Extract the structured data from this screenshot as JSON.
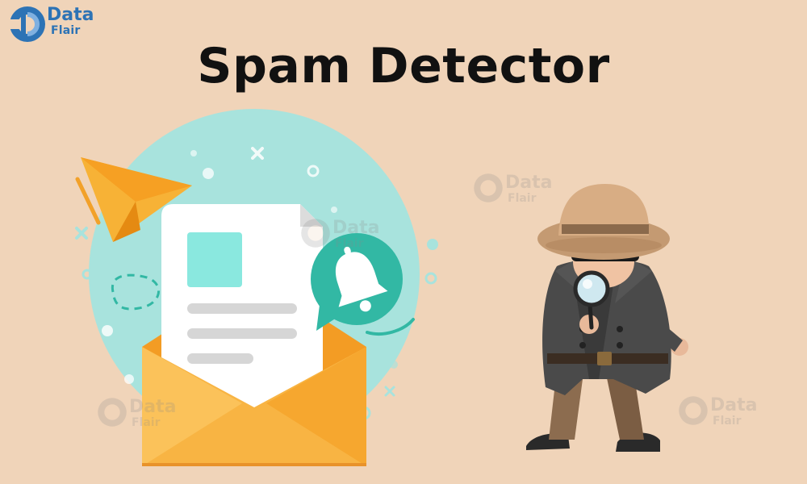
{
  "brand": {
    "line1": "Data",
    "line2": "Flair"
  },
  "title": "Spam Detector",
  "watermarks": [
    {
      "line1": "Data",
      "line2": "Flair"
    },
    {
      "line1": "Data",
      "line2": "Flair"
    },
    {
      "line1": "Data",
      "line2": "Flair"
    },
    {
      "line1": "Data",
      "line2": "Flair"
    }
  ],
  "colors": {
    "background": "#f0d4b9",
    "brand_blue": "#2d73b5",
    "title": "#111111",
    "accent_teal": "#32b8a4",
    "envelope_orange": "#f6a93b",
    "plane_orange": "#f2a12a",
    "circle_bg": "#a8e3dd"
  },
  "icons": [
    "dataflair-logo",
    "paper-plane-icon",
    "envelope-icon",
    "document-icon",
    "bell-icon",
    "spy-detective-figure",
    "magnifying-glass-icon"
  ]
}
